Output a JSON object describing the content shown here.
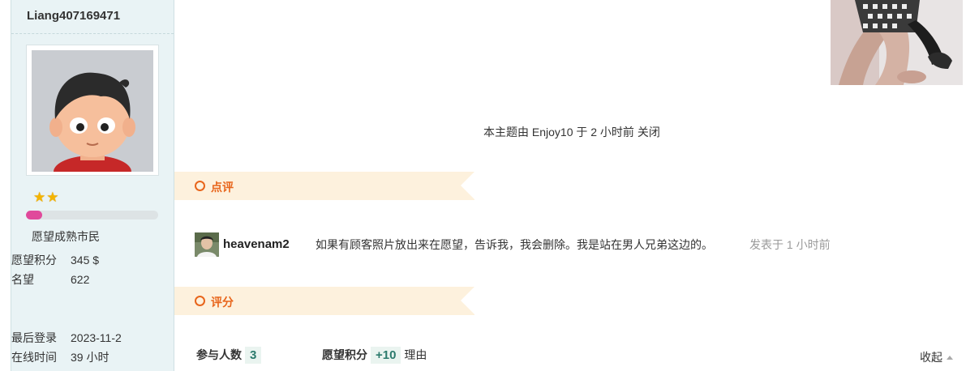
{
  "author": {
    "username": "Liang407169471",
    "stars": "★★",
    "level_progress": 0.12,
    "rank": "愿望成熟市民",
    "stats": [
      {
        "key": "愿望积分",
        "value": "345 $"
      },
      {
        "key": "名望",
        "value": "622"
      }
    ],
    "login_stats": [
      {
        "key": "最后登录",
        "value": "2023-11-2"
      },
      {
        "key": "在线时间",
        "value": "39 小时"
      }
    ]
  },
  "thread": {
    "closed_note": "本主题由 Enjoy10 于 2 小时前 关闭"
  },
  "review_section": {
    "title": "点评",
    "comment": {
      "user": "heavenam2",
      "text": "如果有顾客照片放出来在愿望，告诉我，我会删除。我是站在男人兄弟这边的。",
      "time": "发表于 1 小时前"
    }
  },
  "rating_section": {
    "title": "评分",
    "participants_label": "参与人数",
    "participants_count": "3",
    "points_label": "愿望积分",
    "points_value": "+10",
    "reason_label": "理由",
    "collapse_label": "收起"
  }
}
